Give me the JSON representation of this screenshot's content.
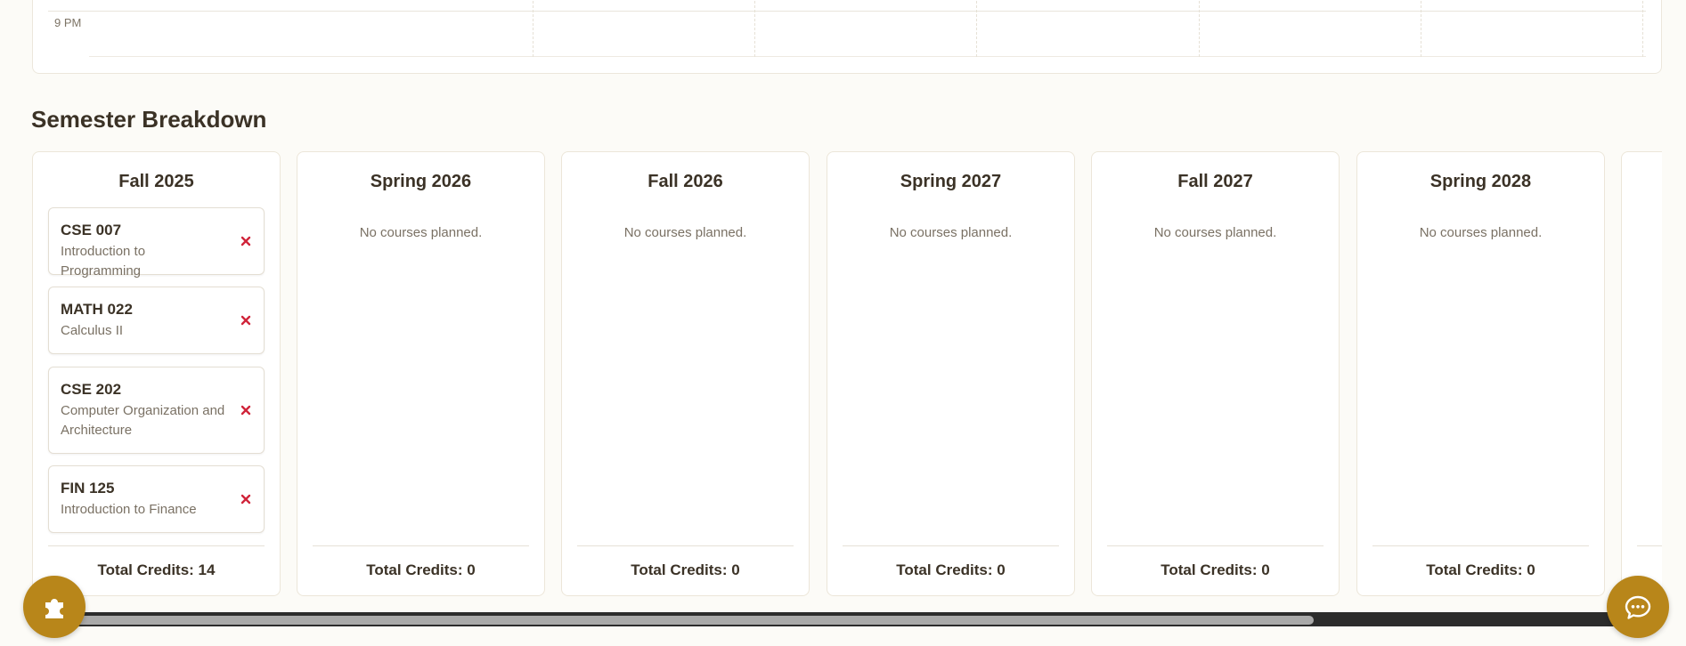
{
  "calendar": {
    "time_label": "9 PM"
  },
  "section": {
    "title": "Semester Breakdown"
  },
  "semesters": [
    {
      "title": "Fall 2025",
      "credits_label": "Total Credits: 14",
      "courses": [
        {
          "code": "CSE 007",
          "name": "Introduction to Programming"
        },
        {
          "code": "MATH 022",
          "name": "Calculus II"
        },
        {
          "code": "CSE 202",
          "name": "Computer Organization and Architecture"
        },
        {
          "code": "FIN 125",
          "name": "Introduction to Finance"
        }
      ]
    },
    {
      "title": "Spring 2026",
      "empty_text": "No courses planned.",
      "credits_label": "Total Credits: 0"
    },
    {
      "title": "Fall 2026",
      "empty_text": "No courses planned.",
      "credits_label": "Total Credits: 0"
    },
    {
      "title": "Spring 2027",
      "empty_text": "No courses planned.",
      "credits_label": "Total Credits: 0"
    },
    {
      "title": "Fall 2027",
      "empty_text": "No courses planned.",
      "credits_label": "Total Credits: 0"
    },
    {
      "title": "Spring 2028",
      "empty_text": "No courses planned.",
      "credits_label": "Total Credits: 0"
    }
  ],
  "icons": {
    "remove": "close-icon",
    "left_fab": "puzzle-icon",
    "right_fab": "chat-icon"
  },
  "colors": {
    "accent": "#b8861a",
    "remove": "#d0243a",
    "background": "#fcfbf7"
  }
}
